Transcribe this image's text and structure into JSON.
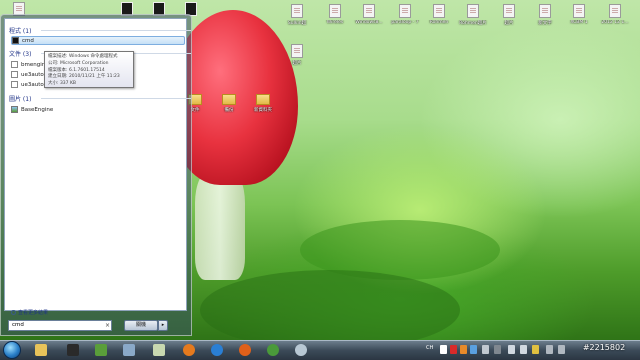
{
  "desktop": {
    "top_icons": [
      {
        "label": "",
        "kind": "dark"
      },
      {
        "label": "",
        "kind": "dark"
      },
      {
        "label": "",
        "kind": "dark"
      },
      {
        "label": "",
        "kind": "dark"
      },
      {
        "label": "Sulkin超",
        "kind": "file"
      },
      {
        "label": "Wireles",
        "kind": "file"
      },
      {
        "label": "Windows8...",
        "kind": "file"
      },
      {
        "label": "paraloop - 7",
        "kind": "file"
      },
      {
        "label": "Rohmen",
        "kind": "file"
      },
      {
        "label": "Rohmen超片",
        "kind": "file"
      },
      {
        "label": "超片",
        "kind": "file"
      },
      {
        "label": "新文字",
        "kind": "file"
      },
      {
        "label": "XCBM 1",
        "kind": "file"
      },
      {
        "label": "2012 12 1...",
        "kind": "file"
      }
    ],
    "second_row": [
      {
        "label": "超片",
        "kind": "file"
      }
    ],
    "third_row": [
      {
        "label": "文件",
        "kind": "folder"
      },
      {
        "label": "備份",
        "kind": "folder"
      },
      {
        "label": "新資料夾",
        "kind": "folder"
      }
    ]
  },
  "start_menu": {
    "groups": [
      {
        "title": "程式 (1)",
        "items": [
          {
            "label": "cmd",
            "icon": "cmd-icon",
            "selected": true
          }
        ]
      },
      {
        "title": "文件 (3)",
        "items": [
          {
            "label": "bmengine.",
            "icon": "document-icon",
            "selected": false
          },
          {
            "label": "ue3auto",
            "icon": "document-icon",
            "selected": false
          },
          {
            "label": "ue3auto",
            "icon": "document-icon",
            "selected": false
          }
        ]
      },
      {
        "title": "圖片 (1)",
        "items": [
          {
            "label": "BaseEngine",
            "icon": "image-icon",
            "selected": false
          }
        ]
      }
    ],
    "tooltip": {
      "line1": "檔案描述: Windows 命令處理程式",
      "line2": "公司: Microsoft Corporation",
      "line3": "檔案版本: 6.1.7601.17514",
      "line4": "建立日期: 2010/11/21 上午 11:23",
      "line5": "大小: 337 KB"
    },
    "see_more": "查看更多結果",
    "search_value": "cmd",
    "clear_symbol": "×",
    "shutdown_label": "關機",
    "shutdown_arrow": "▸"
  },
  "taskbar": {
    "buttons": [
      {
        "name": "folder-explorer",
        "color": "#e8c35a"
      },
      {
        "name": "media-player",
        "color": "#2a2a2a"
      },
      {
        "name": "app-green",
        "color": "#5a9e3a"
      },
      {
        "name": "app-picture",
        "color": "#8aa9c8"
      },
      {
        "name": "firefox",
        "color": "#e57a1e"
      },
      {
        "name": "internet-explorer",
        "color": "#2a7fd4"
      },
      {
        "name": "media-orange",
        "color": "#e0601a"
      },
      {
        "name": "chrome",
        "color": "#4a9a3a"
      },
      {
        "name": "app-swirl",
        "color": "#b8c8d4"
      }
    ],
    "tray": {
      "ime": "CH",
      "clock": "#2215802"
    }
  }
}
